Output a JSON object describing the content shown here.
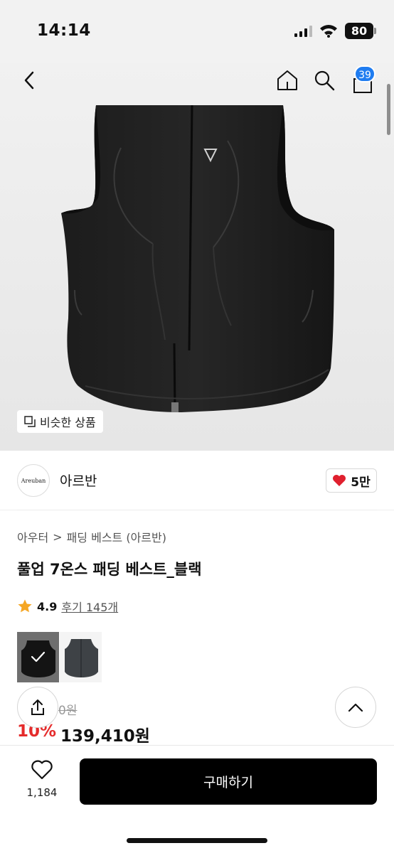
{
  "status_bar": {
    "time": "14:14",
    "battery": "80"
  },
  "nav": {
    "cart_count": "39"
  },
  "hero": {
    "similar_label": "비슷한 상품"
  },
  "brand": {
    "logo_text": "Areuban",
    "name": "아르반",
    "likes": "5만"
  },
  "breadcrumb": {
    "category": "아우터",
    "separator": ">",
    "subcategory": "패딩 베스트 (아르반)"
  },
  "product": {
    "title": "풀업 7온스 패딩 베스트_블랙",
    "rating": "4.9",
    "reviews": "후기 145개",
    "original_price_partial": "0원",
    "discount": "10%",
    "sale_price": "139,410원"
  },
  "bottom_bar": {
    "wish_count": "1,184",
    "buy_label": "구매하기"
  },
  "colors": {
    "accent_blue": "#1f7cf0",
    "sale_red": "#e52b2b",
    "star": "#f5a623",
    "heart": "#e0202e"
  }
}
